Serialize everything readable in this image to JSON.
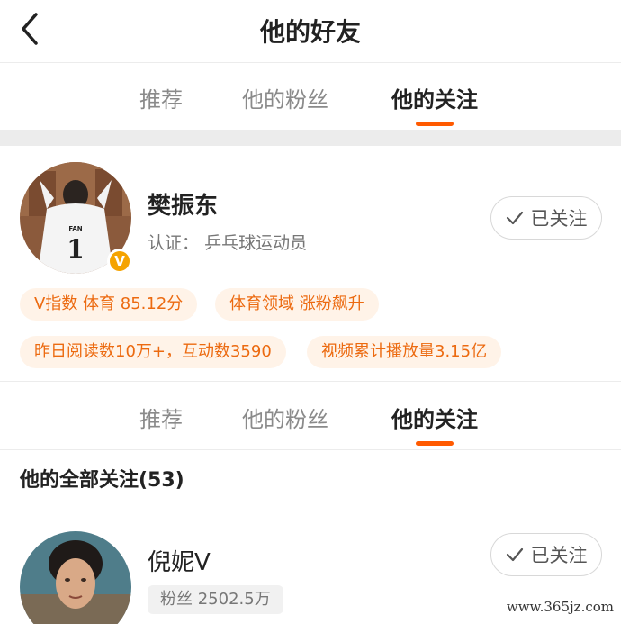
{
  "header": {
    "title": "他的好友"
  },
  "tabs": [
    "推荐",
    "他的粉丝",
    "他的关注"
  ],
  "profile": {
    "name": "樊振东",
    "verify_label": "认证：",
    "verify_value": "乒乓球运动员",
    "follow_label": "已关注",
    "badge": "V",
    "shirt_text": "FAN",
    "shirt_number": "1",
    "tags": [
      "V指数 体育 85.12分",
      "体育领域 涨粉飙升",
      "昨日阅读数10万+，互动数3590",
      "视频累计播放量3.15亿"
    ]
  },
  "list": {
    "heading": "他的全部关注(53)",
    "items": [
      {
        "name": "倪妮V",
        "fans": "粉丝 2502.5万",
        "follow_label": "已关注"
      }
    ]
  },
  "watermark": "www.365jz.com",
  "colors": {
    "accent": "#ff5a00",
    "tag_bg": "#fff3e8",
    "tag_text": "#ec6a10",
    "badge": "#f5a300"
  }
}
